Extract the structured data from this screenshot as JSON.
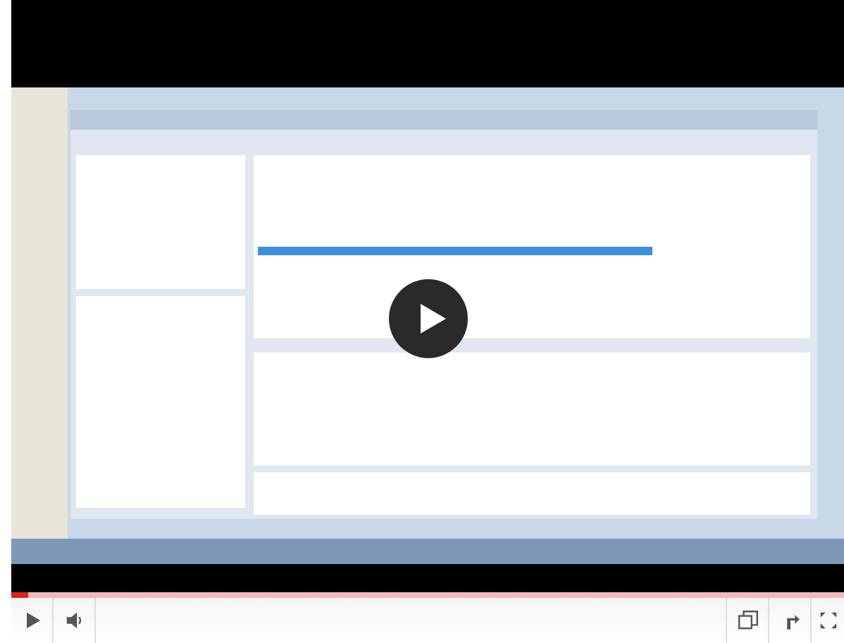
{
  "player": {
    "paused": true,
    "progress": {
      "level": 0.02
    }
  }
}
